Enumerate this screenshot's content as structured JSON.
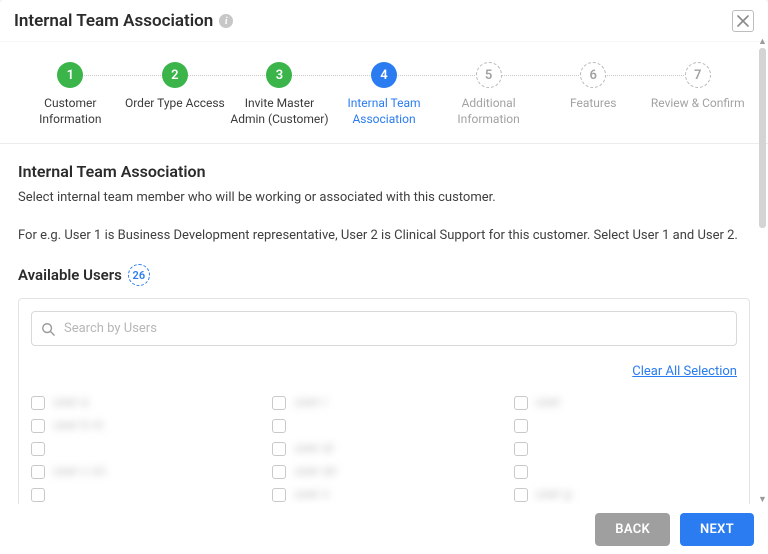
{
  "header": {
    "title": "Internal Team Association"
  },
  "stepper": {
    "steps": [
      {
        "num": "1",
        "label": "Customer Information",
        "state": "done"
      },
      {
        "num": "2",
        "label": "Order Type Access",
        "state": "done"
      },
      {
        "num": "3",
        "label": "Invite Master Admin (Customer)",
        "state": "done"
      },
      {
        "num": "4",
        "label": "Internal Team Association",
        "state": "active"
      },
      {
        "num": "5",
        "label": "Additional Information",
        "state": "pending"
      },
      {
        "num": "6",
        "label": "Features",
        "state": "pending"
      },
      {
        "num": "7",
        "label": "Review & Confirm",
        "state": "pending"
      }
    ]
  },
  "section": {
    "title": "Internal Team Association",
    "description": "Select internal team member who will be working or associated with this customer.",
    "example": "For e.g. User 1 is Business Development representative, User 2 is Clinical Support for this customer. Select User 1 and User 2."
  },
  "available": {
    "label": "Available Users",
    "count": "26"
  },
  "search": {
    "placeholder": "Search by Users",
    "value": ""
  },
  "actions": {
    "clear_all": "Clear All Selection"
  },
  "users": {
    "col1": [
      "user a",
      "user b nt",
      "",
      "user c on",
      ""
    ],
    "col2": [
      "user r",
      "",
      "user al",
      "user air",
      "user x"
    ],
    "col3": [
      "user",
      "",
      "",
      "",
      "user g"
    ]
  },
  "footer": {
    "back": "BACK",
    "next": "NEXT"
  }
}
